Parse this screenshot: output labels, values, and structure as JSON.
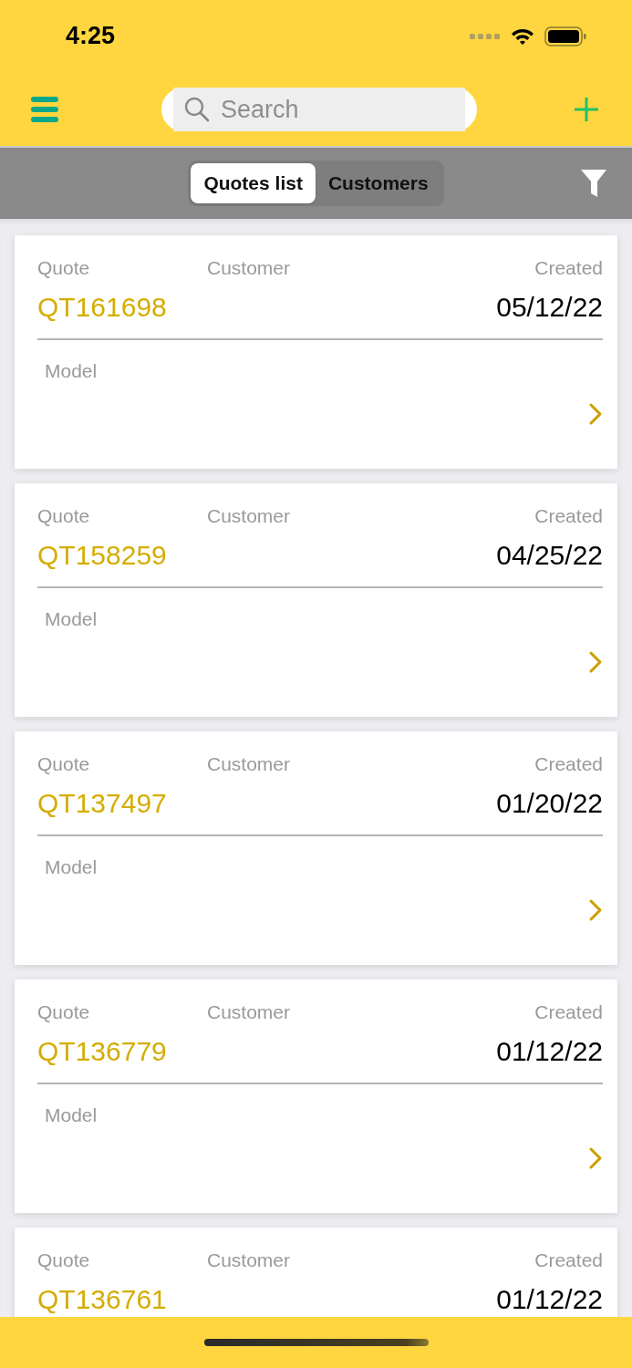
{
  "status_bar": {
    "time": "4:25"
  },
  "nav": {
    "search": {
      "placeholder": "Search"
    }
  },
  "tabs": [
    {
      "label": "Quotes list",
      "selected": true
    },
    {
      "label": "Customers",
      "selected": false
    }
  ],
  "quotes": [
    {
      "quote_label": "Quote",
      "customer_label": "Customer",
      "created_label": "Created",
      "quote": "QT161698",
      "created": "05/12/22",
      "model_label": "Model"
    },
    {
      "quote_label": "Quote",
      "customer_label": "Customer",
      "created_label": "Created",
      "quote": "QT158259",
      "created": "04/25/22",
      "model_label": "Model"
    },
    {
      "quote_label": "Quote",
      "customer_label": "Customer",
      "created_label": "Created",
      "quote": "QT137497",
      "created": "01/20/22",
      "model_label": "Model"
    },
    {
      "quote_label": "Quote",
      "customer_label": "Customer",
      "created_label": "Created",
      "quote": "QT136779",
      "created": "01/12/22",
      "model_label": "Model"
    },
    {
      "quote_label": "Quote",
      "customer_label": "Customer",
      "created_label": "Created",
      "quote": "QT136761",
      "created": "01/12/22"
    }
  ]
}
